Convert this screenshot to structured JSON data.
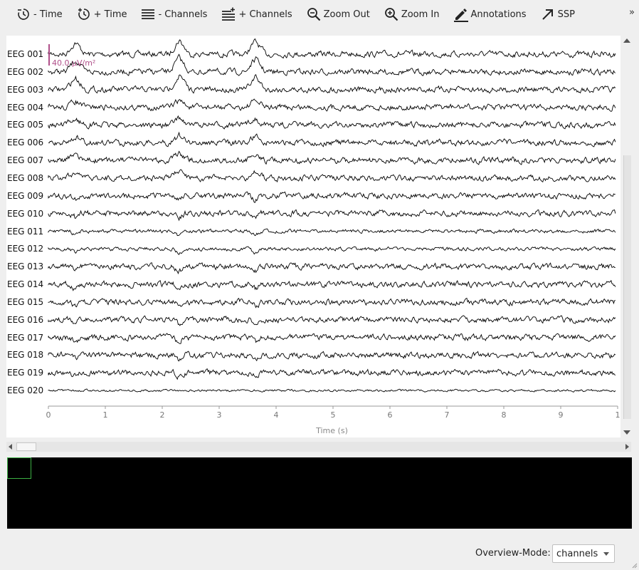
{
  "toolbar": {
    "time_minus": "- Time",
    "time_plus": "+ Time",
    "channels_minus": "- Channels",
    "channels_plus": "+ Channels",
    "zoom_out": "Zoom Out",
    "zoom_in": "Zoom In",
    "annotations": "Annotations",
    "ssp": "SSP",
    "overflow": "»"
  },
  "plot": {
    "channels": [
      "EEG 001",
      "EEG 002",
      "EEG 003",
      "EEG 004",
      "EEG 005",
      "EEG 006",
      "EEG 007",
      "EEG 008",
      "EEG 009",
      "EEG 010",
      "EEG 011",
      "EEG 012",
      "EEG 013",
      "EEG 014",
      "EEG 015",
      "EEG 016",
      "EEG 017",
      "EEG 018",
      "EEG 019",
      "EEG 020"
    ],
    "x_ticks": [
      "0",
      "1",
      "2",
      "3",
      "4",
      "5",
      "6",
      "7",
      "8",
      "9",
      "1"
    ],
    "x_label": "Time (s)",
    "scale_label": "40.0 µV/m²",
    "trace_color": "#000000",
    "scale_color": "#b0508a"
  },
  "overview": {
    "mode_label": "Overview-Mode:",
    "mode_value": "channels",
    "box_color": "#3cb043"
  }
}
